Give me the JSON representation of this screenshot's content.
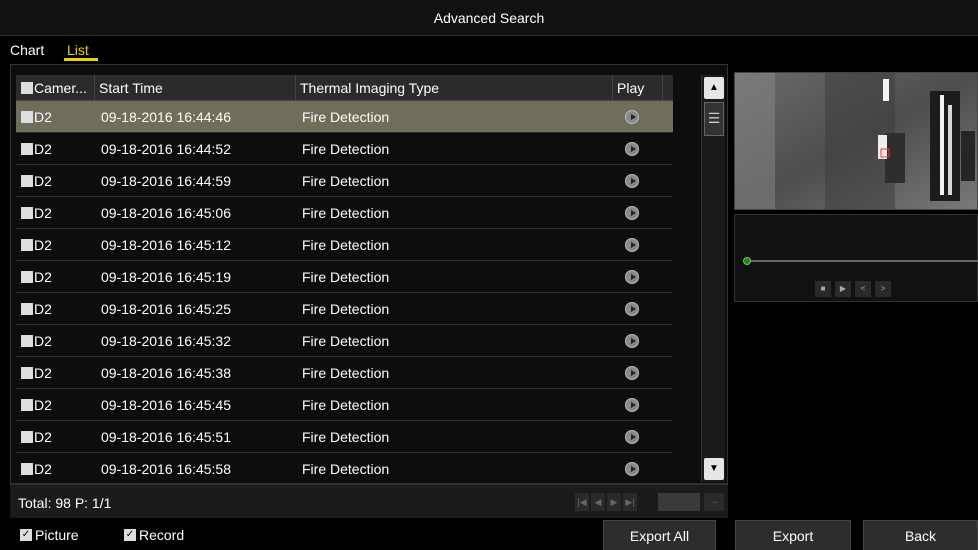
{
  "window": {
    "title": "Advanced Search"
  },
  "tabs": {
    "chart": "Chart",
    "list": "List"
  },
  "table": {
    "headers": {
      "camera": "Camer...",
      "start_time": "Start Time",
      "type": "Thermal Imaging Type",
      "play": "Play"
    },
    "rows": [
      {
        "camera": "D2",
        "start_time": "09-18-2016 16:44:46",
        "type": "Fire Detection"
      },
      {
        "camera": "D2",
        "start_time": "09-18-2016 16:44:52",
        "type": "Fire Detection"
      },
      {
        "camera": "D2",
        "start_time": "09-18-2016 16:44:59",
        "type": "Fire Detection"
      },
      {
        "camera": "D2",
        "start_time": "09-18-2016 16:45:06",
        "type": "Fire Detection"
      },
      {
        "camera": "D2",
        "start_time": "09-18-2016 16:45:12",
        "type": "Fire Detection"
      },
      {
        "camera": "D2",
        "start_time": "09-18-2016 16:45:19",
        "type": "Fire Detection"
      },
      {
        "camera": "D2",
        "start_time": "09-18-2016 16:45:25",
        "type": "Fire Detection"
      },
      {
        "camera": "D2",
        "start_time": "09-18-2016 16:45:32",
        "type": "Fire Detection"
      },
      {
        "camera": "D2",
        "start_time": "09-18-2016 16:45:38",
        "type": "Fire Detection"
      },
      {
        "camera": "D2",
        "start_time": "09-18-2016 16:45:45",
        "type": "Fire Detection"
      },
      {
        "camera": "D2",
        "start_time": "09-18-2016 16:45:51",
        "type": "Fire Detection"
      },
      {
        "camera": "D2",
        "start_time": "09-18-2016 16:45:58",
        "type": "Fire Detection"
      }
    ]
  },
  "footer": {
    "total": "Total: 98  P: 1/1"
  },
  "options": {
    "picture": "Picture",
    "record": "Record"
  },
  "buttons": {
    "export_all": "Export All",
    "export": "Export",
    "back": "Back"
  },
  "icons": {
    "play": "play-circle-icon",
    "scroll_up": "chevron-up-icon",
    "scroll_down": "chevron-down-icon",
    "first_page": "first-page-icon",
    "prev_page": "prev-page-icon",
    "next_page": "next-page-icon",
    "last_page": "last-page-icon",
    "go": "go-arrow-icon",
    "stop": "stop-icon",
    "play_ctrl": "play-icon",
    "step_back": "step-back-icon",
    "step_forward": "step-forward-icon"
  },
  "colors": {
    "accent": "#f0d000",
    "selected_row": "#6f6e5b"
  }
}
